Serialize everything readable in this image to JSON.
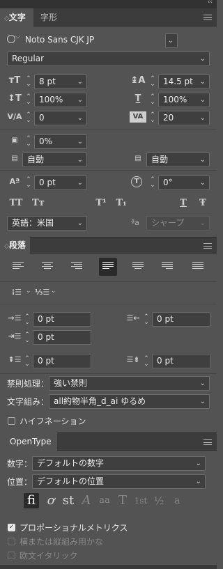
{
  "header": {
    "collapse_glyph": "‹‹"
  },
  "tabs": {
    "character": "文字",
    "glyphs": "字形"
  },
  "character": {
    "font_family": "Noto Sans CJK JP",
    "font_style": "Regular",
    "font_size": "8 pt",
    "leading": "14.5 pt",
    "vertical_scale": "100%",
    "horizontal_scale": "100%",
    "kerning": "0",
    "tracking": "20",
    "tsume": "0%",
    "aki_left": "自動",
    "aki_right": "自動",
    "baseline_shift": "0 pt",
    "rotation": "0°",
    "language": "英語：米国",
    "antialias": "シャープ",
    "antialias_icon": "ªa",
    "style_buttons": [
      "TT",
      "Tт",
      "T¹",
      "T₁",
      "T",
      "Ŧ"
    ]
  },
  "paragraph": {
    "title": "段落",
    "indent_left": "0 pt",
    "indent_right": "0 pt",
    "first_line": "0 pt",
    "space_before": "0 pt",
    "space_after": "0 pt",
    "kinsoku_label": "禁則処理：",
    "kinsoku_value": "強い禁則",
    "mojikumi_label": "文字組み：",
    "mojikumi_value": "all約物半角_d_ai ゆるめ",
    "hyphenation_label": "ハイフネーション"
  },
  "opentype": {
    "title": "OpenType",
    "numbers_label": "数字：",
    "numbers_value": "デフォルトの数字",
    "position_label": "位置：",
    "position_value": "デフォルトの位置",
    "buttons": [
      "fi",
      "ơ",
      "st",
      "A",
      "aa",
      "T",
      "1st",
      "½",
      "a"
    ],
    "proportional_label": "プロポーショナルメトリクス",
    "vertical_kana_label": "横または縦組み用かな",
    "roman_italic_label": "欧文イタリック"
  },
  "colors": {
    "panel": "#535353",
    "header": "#3c3c3c",
    "field": "#3f3f3f"
  }
}
